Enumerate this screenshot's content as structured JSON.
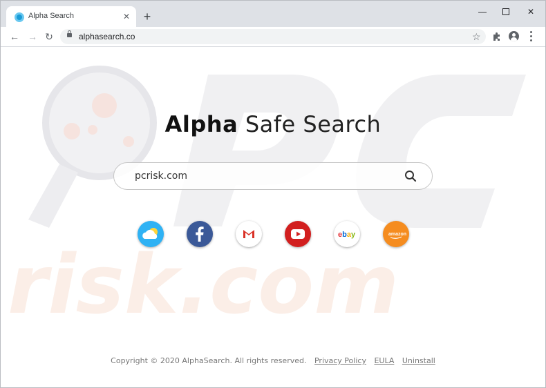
{
  "browser": {
    "tab": {
      "title": "Alpha Search",
      "close_glyph": "✕"
    },
    "new_tab_glyph": "+",
    "window_controls": {
      "minimize": "—",
      "maximize": "☐",
      "close": "✕"
    },
    "nav": {
      "back": "←",
      "forward": "→",
      "reload": "↻"
    },
    "address_bar": {
      "url": "alphasearch.co",
      "secure": true
    },
    "icons": [
      "bookmark-star-icon",
      "extensions-puzzle-icon",
      "profile-icon",
      "menu-kebab-icon"
    ]
  },
  "page": {
    "title_bold": "Alpha",
    "title_light": "Safe Search",
    "search": {
      "value": "pcrisk.com"
    },
    "shortcuts": [
      {
        "name": "weather",
        "color": "#2fb2f4"
      },
      {
        "name": "facebook",
        "color": "#3b5998"
      },
      {
        "name": "gmail",
        "color": "#ffffff"
      },
      {
        "name": "youtube",
        "color": "#d21f1f"
      },
      {
        "name": "ebay",
        "color": "#ffffff"
      },
      {
        "name": "amazon",
        "color": "#f58c1f"
      }
    ],
    "footer": {
      "copyright": "Copyright © 2020 AlphaSearch. All rights reserved.",
      "links": [
        "Privacy Policy",
        "EULA",
        "Uninstall"
      ]
    },
    "watermark_text": "risk.com",
    "watermark_logo": "PC"
  }
}
